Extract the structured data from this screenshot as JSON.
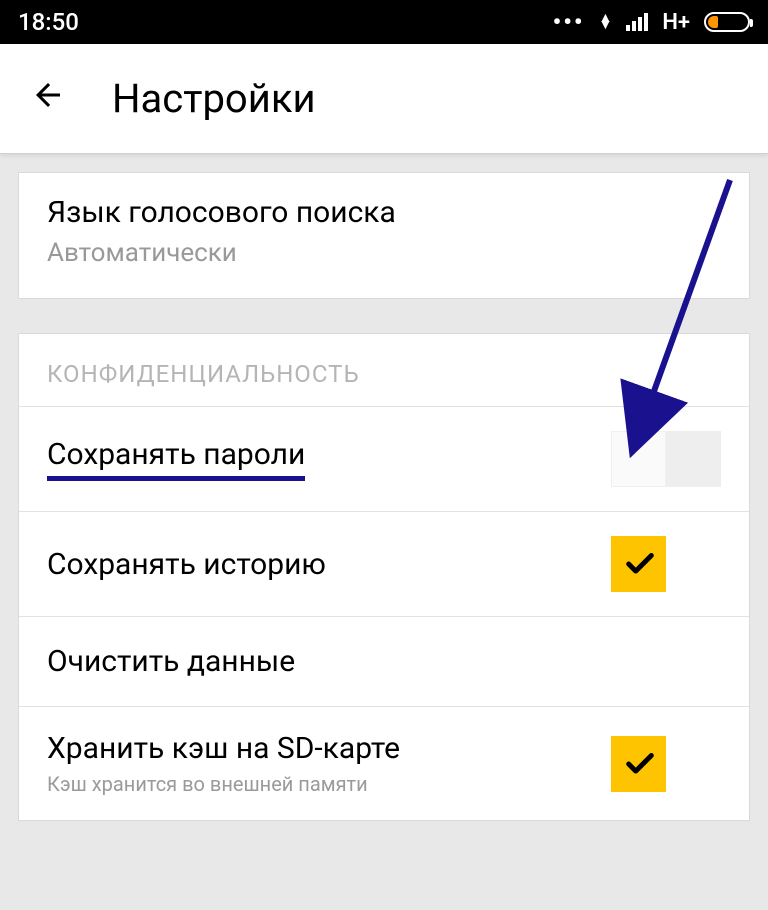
{
  "statusbar": {
    "time": "18:50",
    "network": "H+"
  },
  "header": {
    "title": "Настройки"
  },
  "voice_search": {
    "title": "Язык голосового поиска",
    "value": "Автоматически"
  },
  "privacy": {
    "section_label": "КОНФИДЕНЦИАЛЬНОСТЬ",
    "items": [
      {
        "label": "Сохранять пароли",
        "toggle": "off",
        "highlighted": true
      },
      {
        "label": "Сохранять историю",
        "toggle": "on"
      },
      {
        "label": "Очистить данные"
      },
      {
        "label": "Хранить кэш на SD-карте",
        "desc": "Кэш хранится во внешней памяти",
        "toggle": "on"
      }
    ]
  },
  "annotation": {
    "arrow_color": "#1a118f"
  }
}
